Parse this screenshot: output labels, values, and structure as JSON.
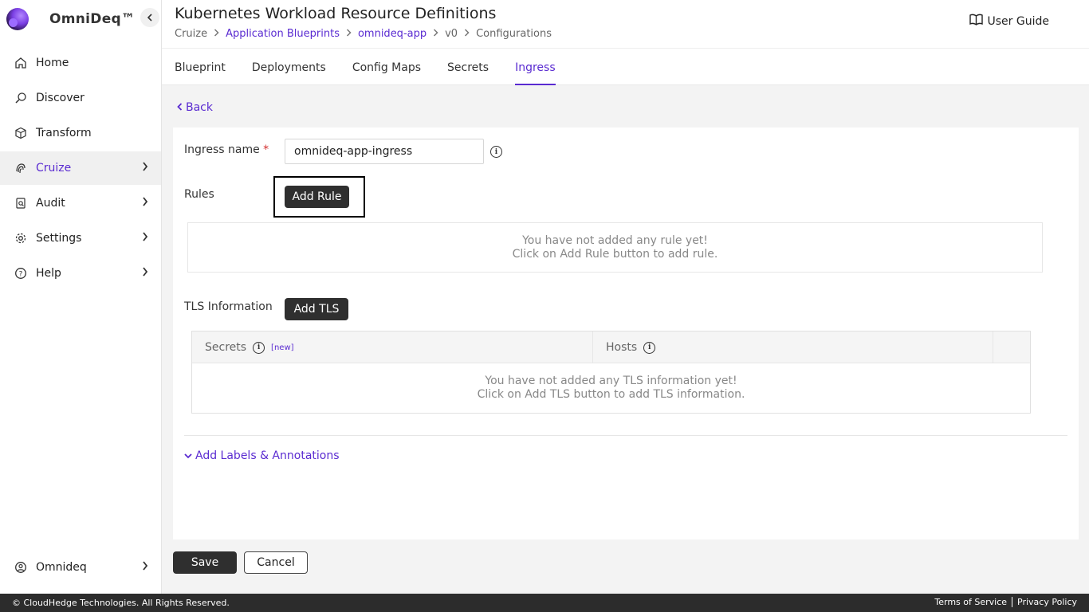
{
  "app": {
    "name": "OmniDeq™"
  },
  "sidebar": {
    "items": [
      {
        "label": "Home",
        "icon": "home-icon"
      },
      {
        "label": "Discover",
        "icon": "discover-icon"
      },
      {
        "label": "Transform",
        "icon": "cube-icon"
      },
      {
        "label": "Cruize",
        "icon": "fingerprint-icon"
      },
      {
        "label": "Audit",
        "icon": "audit-icon"
      },
      {
        "label": "Settings",
        "icon": "gear-icon"
      },
      {
        "label": "Help",
        "icon": "help-icon"
      }
    ],
    "user": {
      "label": "Omnideq",
      "icon": "user-icon"
    }
  },
  "header": {
    "title": "Kubernetes Workload Resource Definitions",
    "breadcrumb": [
      "Cruize",
      "Application Blueprints",
      "omnideq-app",
      "v0",
      "Configurations"
    ],
    "user_guide": "User Guide"
  },
  "tabs": [
    "Blueprint",
    "Deployments",
    "Config Maps",
    "Secrets",
    "Ingress"
  ],
  "back_label": "Back",
  "form": {
    "ingress_name_label": "Ingress name",
    "ingress_name_value": "omnideq-app-ingress",
    "rules_label": "Rules",
    "add_rule": "Add Rule",
    "rules_empty_1": "You have not added any rule yet!",
    "rules_empty_2": "Click on Add Rule button to add rule.",
    "tls_label": "TLS Information",
    "add_tls": "Add TLS",
    "tls_col_secrets": "Secrets",
    "tls_new": "[new]",
    "tls_col_hosts": "Hosts",
    "tls_empty_1": "You have not added any TLS information yet!",
    "tls_empty_2": "Click on Add TLS button to add TLS information.",
    "labels_annotations": "Add Labels & Annotations"
  },
  "actions": {
    "save": "Save",
    "cancel": "Cancel"
  },
  "footer": {
    "copyright": "© CloudHedge Technologies. All Rights Reserved.",
    "terms": "Terms of Service",
    "privacy": "Privacy Policy"
  },
  "colors": {
    "accent": "#5a2bd1",
    "dark_button": "#2f2f2f",
    "footer_bg": "#2c2c2c"
  }
}
